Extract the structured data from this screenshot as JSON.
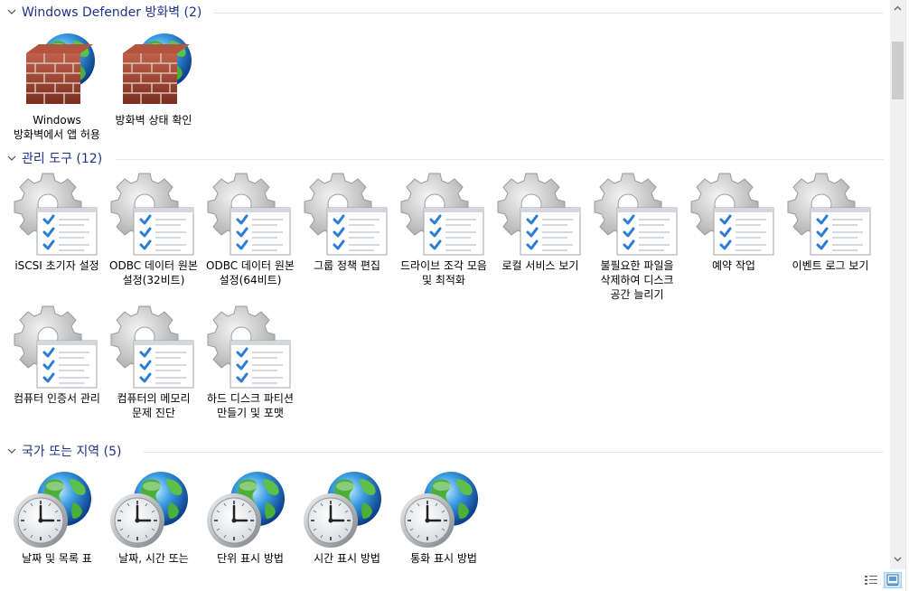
{
  "groups": [
    {
      "title": "Windows Defender 방화벽 (2)",
      "icon": "firewall-icon",
      "items": [
        {
          "label": "Windows 방화벽에서 앱 허용"
        },
        {
          "label": "방화벽 상태 확인"
        }
      ]
    },
    {
      "title": "관리 도구 (12)",
      "icon": "admin-tools-icon",
      "items": [
        {
          "label": "iSCSI 초기자 설정"
        },
        {
          "label": "ODBC 데이터 원본 설정(32비트)"
        },
        {
          "label": "ODBC 데이터 원본 설정(64비트)"
        },
        {
          "label": "그룹 정책 편집"
        },
        {
          "label": "드라이브 조각 모음 및 최적화"
        },
        {
          "label": "로컬 서비스 보기"
        },
        {
          "label": "불필요한 파일을 삭제하여 디스크 공간 늘리기"
        },
        {
          "label": "예약 작업"
        },
        {
          "label": "이벤트 로그 보기"
        },
        {
          "label": "컴퓨터 인증서 관리"
        },
        {
          "label": "컴퓨터의 메모리 문제 진단"
        },
        {
          "label": "하드 디스크 파티션 만들기 및 포맷"
        }
      ]
    },
    {
      "title": "국가 또는 지역 (5)",
      "icon": "region-clock-icon",
      "items": [
        {
          "label": "날짜 및 목록 표"
        },
        {
          "label": "날짜, 시간 또는"
        },
        {
          "label": "단위 표시 방법"
        },
        {
          "label": "시간 표시 방법"
        },
        {
          "label": "통화 표시 방법"
        }
      ]
    }
  ],
  "statusbar": {
    "details_view_icon": "details-view-icon",
    "large_icons_view_icon": "large-icons-view-icon"
  },
  "colors": {
    "group_title": "#1e3287",
    "group_line": "#e3e8f4",
    "selected_view": "#cce8ff"
  }
}
